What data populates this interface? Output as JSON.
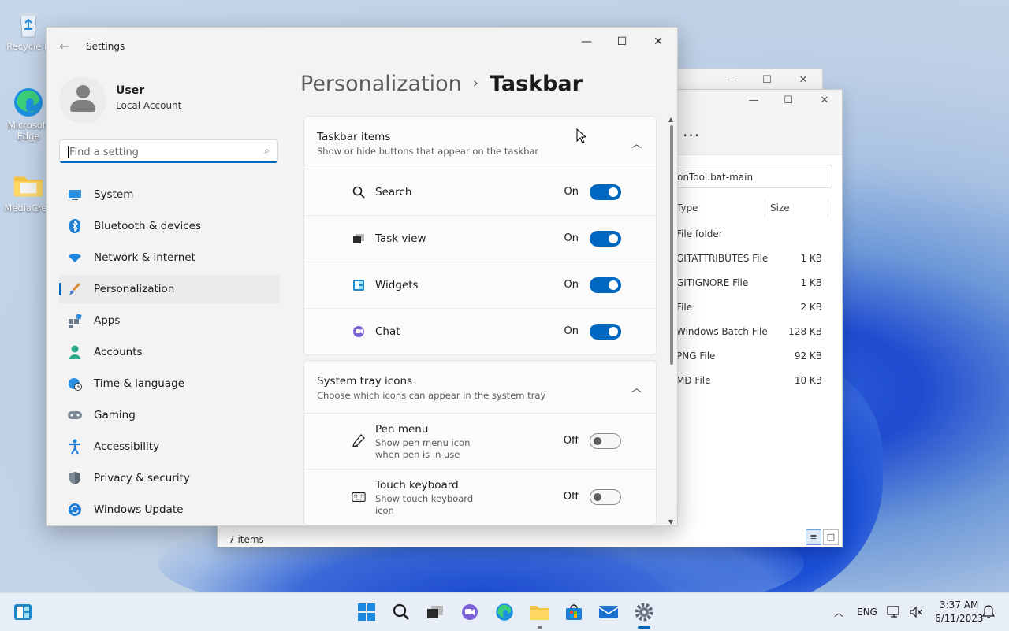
{
  "desktop": {
    "icons": [
      {
        "label": "Recycle B",
        "icon": "recycle-bin-icon"
      },
      {
        "label": "Microsoft Edge",
        "icon": "edge-icon"
      },
      {
        "label": "MediaCrea",
        "icon": "folder-icon"
      }
    ]
  },
  "explorer": {
    "address": "onTool.bat-main",
    "columns": [
      "Type",
      "Size"
    ],
    "rows": [
      {
        "type": "File folder",
        "size": ""
      },
      {
        "type": "GITATTRIBUTES File",
        "size": "1 KB"
      },
      {
        "type": "GITIGNORE File",
        "size": "1 KB"
      },
      {
        "type": "File",
        "size": "2 KB"
      },
      {
        "type": "Windows Batch File",
        "size": "128 KB"
      },
      {
        "type": "PNG File",
        "size": "92 KB"
      },
      {
        "type": "MD File",
        "size": "10 KB"
      }
    ],
    "status": "7 items",
    "more": "..."
  },
  "settings": {
    "title": "Settings",
    "user": {
      "name": "User",
      "account": "Local Account"
    },
    "search": {
      "placeholder": "Find a setting"
    },
    "nav": [
      {
        "label": "System",
        "icon": "monitor-icon"
      },
      {
        "label": "Bluetooth & devices",
        "icon": "bluetooth-icon"
      },
      {
        "label": "Network & internet",
        "icon": "wifi-icon"
      },
      {
        "label": "Personalization",
        "icon": "brush-icon",
        "active": true
      },
      {
        "label": "Apps",
        "icon": "apps-icon"
      },
      {
        "label": "Accounts",
        "icon": "person-icon"
      },
      {
        "label": "Time & language",
        "icon": "globe-clock-icon"
      },
      {
        "label": "Gaming",
        "icon": "gamepad-icon"
      },
      {
        "label": "Accessibility",
        "icon": "accessibility-icon"
      },
      {
        "label": "Privacy & security",
        "icon": "shield-icon"
      },
      {
        "label": "Windows Update",
        "icon": "update-icon"
      }
    ],
    "breadcrumb": {
      "parent": "Personalization",
      "separator": "›",
      "current": "Taskbar"
    },
    "sections": [
      {
        "title": "Taskbar items",
        "subtitle": "Show or hide buttons that appear on the taskbar",
        "items": [
          {
            "label": "Search",
            "state": "On",
            "on": true,
            "icon": "search-icon"
          },
          {
            "label": "Task view",
            "state": "On",
            "on": true,
            "icon": "task-view-icon"
          },
          {
            "label": "Widgets",
            "state": "On",
            "on": true,
            "icon": "widgets-icon"
          },
          {
            "label": "Chat",
            "state": "On",
            "on": true,
            "icon": "chat-icon"
          }
        ]
      },
      {
        "title": "System tray icons",
        "subtitle": "Choose which icons can appear in the system tray",
        "items": [
          {
            "label": "Pen menu",
            "desc": "Show pen menu icon when pen is in use",
            "state": "Off",
            "on": false,
            "icon": "pen-icon"
          },
          {
            "label": "Touch keyboard",
            "desc": "Show touch keyboard icon",
            "state": "Off",
            "on": false,
            "icon": "keyboard-icon"
          }
        ]
      }
    ]
  },
  "taskbar": {
    "language": "ENG",
    "time": "3:37 AM",
    "date": "6/11/2023",
    "pinned": [
      "start-icon",
      "search-icon",
      "task-view-icon",
      "chat-icon",
      "edge-icon",
      "file-explorer-icon",
      "store-icon",
      "mail-icon",
      "settings-icon"
    ]
  },
  "colors": {
    "accent": "#0067c0"
  }
}
